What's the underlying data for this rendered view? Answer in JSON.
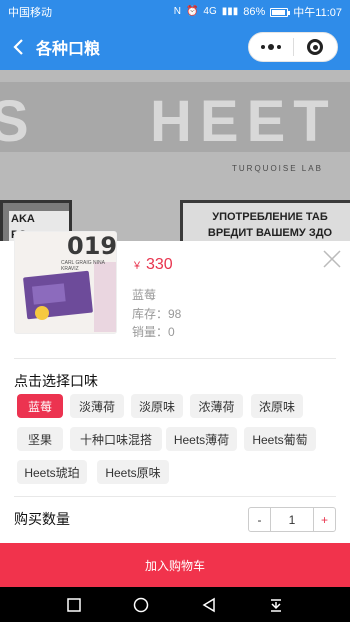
{
  "status_bar": {
    "carrier": "中国移动",
    "battery": "86%",
    "time": "中午11:07",
    "signal": "4G"
  },
  "nav": {
    "title": "各种口粮"
  },
  "background": {
    "brand_fragment_left": "S",
    "brand_fragment": "HEET",
    "subtitle": "TURQUOISE LAB",
    "warning_left": "AKA\nPO",
    "warning": "УПОТРЕБЛЕНИЕ ТАБ\nВРЕДИТ ВАШЕМУ ЗДО"
  },
  "product": {
    "thumb_number": "019",
    "thumb_small_text": "CARL GRAIG NINA KRAVIZ",
    "currency": "￥",
    "price": "330",
    "selected_flavor": "蓝莓",
    "stock": "库存：98",
    "sales": "销量：0"
  },
  "flavor_section": {
    "title": "点击选择口味",
    "options": [
      {
        "label": "蓝莓",
        "active": true
      },
      {
        "label": "淡薄荷",
        "active": false
      },
      {
        "label": "淡原味",
        "active": false
      },
      {
        "label": "浓薄荷",
        "active": false
      },
      {
        "label": "浓原味",
        "active": false
      },
      {
        "label": "坚果",
        "active": false
      },
      {
        "label": "十种口味混搭",
        "active": false
      },
      {
        "label": "Heets薄荷",
        "active": false
      },
      {
        "label": "Heets葡萄",
        "active": false
      },
      {
        "label": "Heets琥珀",
        "active": false
      },
      {
        "label": "Heets原味",
        "active": false
      }
    ]
  },
  "quantity": {
    "label": "购买数量",
    "minus": "-",
    "value": "1",
    "plus": "+"
  },
  "cart_button": "加入购物车",
  "colors": {
    "nav_blue": "#2f8ce9",
    "accent_red": "#ec3350",
    "chip_bg": "#f1f1f1"
  }
}
